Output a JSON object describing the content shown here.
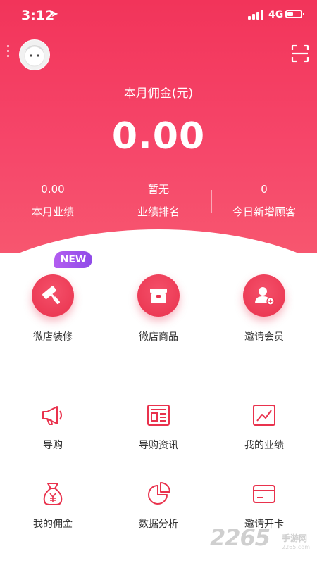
{
  "status_bar": {
    "time": "3:12",
    "network": "4G"
  },
  "header": {
    "commission_title": "本月佣金(元)",
    "commission_value": "0.00"
  },
  "stats": [
    {
      "value": "0.00",
      "label": "本月业绩"
    },
    {
      "value": "暂无",
      "label": "业绩排名"
    },
    {
      "value": "0",
      "label": "今日新增顾客"
    }
  ],
  "features": [
    {
      "label": "微店装修",
      "icon": "paint-roller-icon",
      "badge": "NEW"
    },
    {
      "label": "微店商品",
      "icon": "box-icon"
    },
    {
      "label": "邀请会员",
      "icon": "add-user-icon"
    }
  ],
  "tools": [
    {
      "label": "导购",
      "icon": "megaphone-icon"
    },
    {
      "label": "导购资讯",
      "icon": "news-icon"
    },
    {
      "label": "我的业绩",
      "icon": "line-chart-icon"
    },
    {
      "label": "我的佣金",
      "icon": "money-bag-icon"
    },
    {
      "label": "数据分析",
      "icon": "pie-chart-icon"
    },
    {
      "label": "邀请开卡",
      "icon": "card-icon"
    }
  ],
  "watermark": {
    "number": "2265",
    "text": "手游网",
    "url": "2265.com"
  },
  "colors": {
    "brand": "#f2345a",
    "accent": "#e9324d",
    "badge": "#a557ee"
  }
}
